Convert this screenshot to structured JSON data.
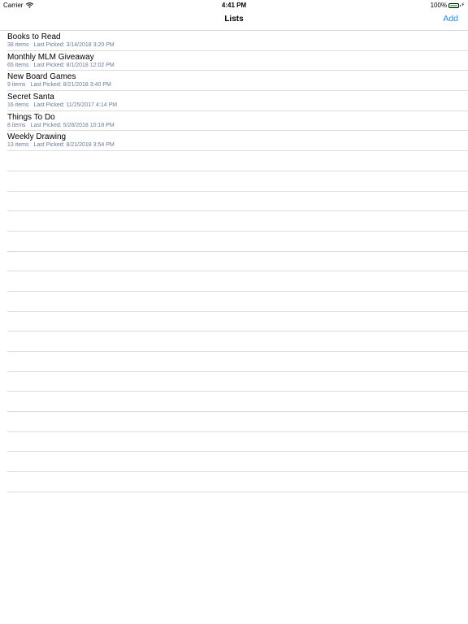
{
  "status_bar": {
    "carrier": "Carrier",
    "time": "4:41 PM",
    "battery": "100%"
  },
  "nav": {
    "title": "Lists",
    "add_label": "Add"
  },
  "lists": [
    {
      "title": "Books to Read",
      "count": "38 items",
      "last_picked": "Last Picked: 3/14/2018 3:20 PM"
    },
    {
      "title": "Monthly MLM Giveaway",
      "count": "65 items",
      "last_picked": "Last Picked: 8/1/2018 12:02 PM"
    },
    {
      "title": "New Board Games",
      "count": "9 items",
      "last_picked": "Last Picked: 8/21/2018 3:40 PM"
    },
    {
      "title": "Secret Santa",
      "count": "16 items",
      "last_picked": "Last Picked: 11/25/2017 4:14 PM"
    },
    {
      "title": "Things To Do",
      "count": "8 items",
      "last_picked": "Last Picked: 5/28/2018 10:18 PM"
    },
    {
      "title": "Weekly Drawing",
      "count": "13 items",
      "last_picked": "Last Picked: 8/21/2018 3:54 PM"
    }
  ],
  "colors": {
    "accent": "#1a8cff",
    "subtitle": "#6a7a96",
    "separator": "#dcdcdc",
    "battery": "#4cd964"
  },
  "icons": {
    "wifi": "wifi-icon",
    "battery": "battery-icon",
    "charging": "charging-icon"
  }
}
